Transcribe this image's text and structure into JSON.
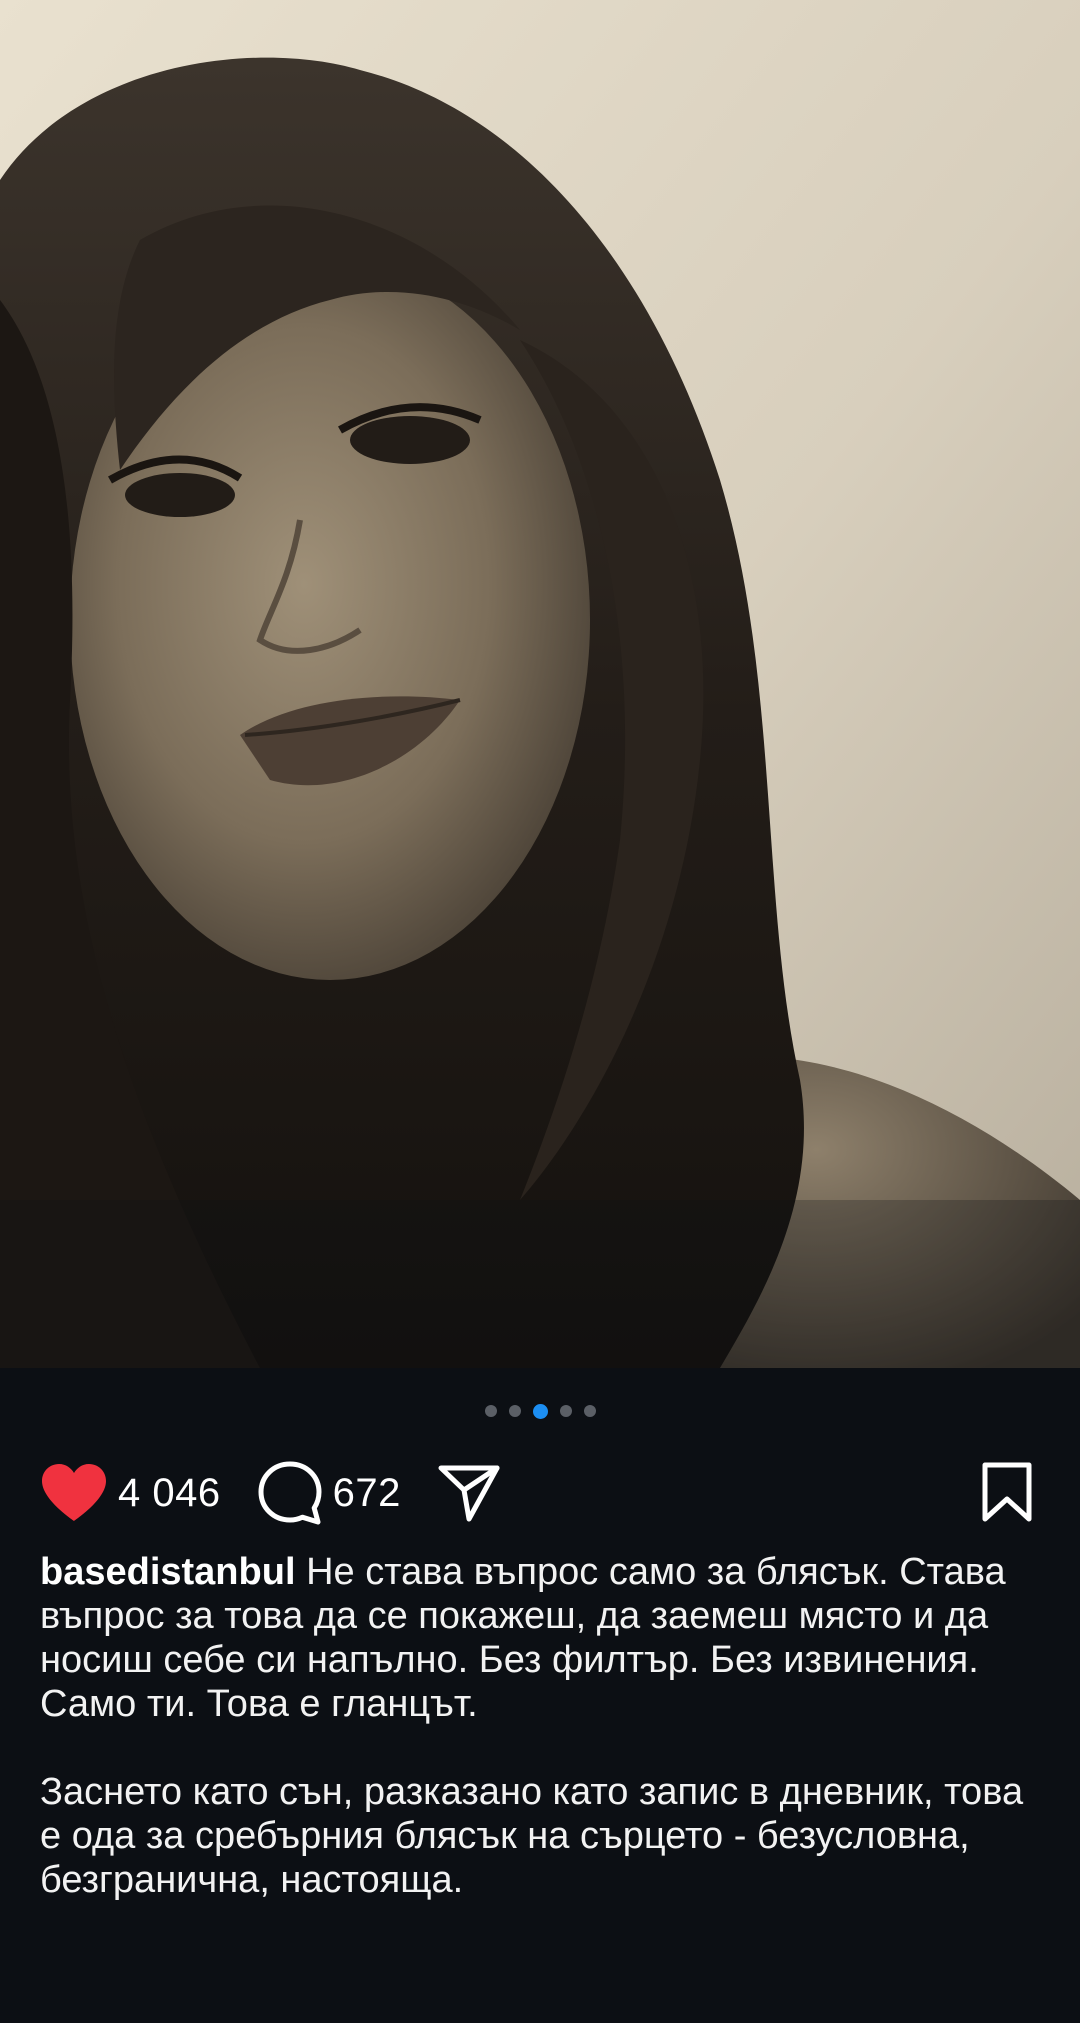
{
  "post": {
    "carousel": {
      "total": 5,
      "active_index": 3
    },
    "likes": "4 046",
    "comments": "672",
    "username": "basedistanbul",
    "caption_p1": "Не става въпрос само за блясък. Става въпрос за това да се покажеш, да заемеш място и да носиш себе си напълно. Без филтър. Без извинения. Само ти. Това е гланцът.",
    "caption_p2": "Заснето като сън, разказано като запис в дневник, това е ода за сребърния блясък на сърцето - безусловна, безгранична, настояща."
  },
  "icons": {
    "like": "heart-icon",
    "comment": "comment-bubble-icon",
    "share": "send-paper-plane-icon",
    "save": "bookmark-icon"
  },
  "colors": {
    "background": "#0c0f14",
    "heart": "#f0323f",
    "active_dot": "#1c8ef2",
    "inactive_dot": "#5b5f66"
  }
}
